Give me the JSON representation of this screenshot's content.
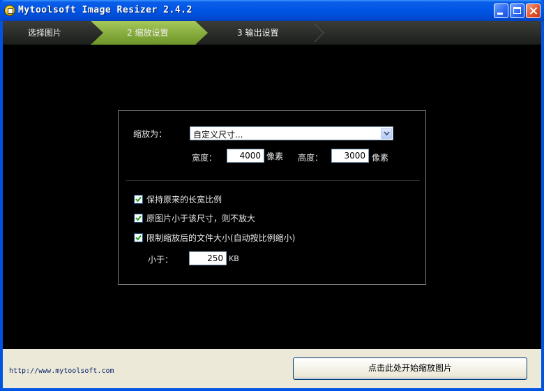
{
  "window": {
    "title": "Mytoolsoft Image Resizer 2.4.2"
  },
  "steps": [
    {
      "label": "选择图片"
    },
    {
      "label": "2  缩放设置"
    },
    {
      "label": "3  输出设置"
    }
  ],
  "resize": {
    "label": "缩放为：",
    "selected": "自定义尺寸...",
    "width_label": "宽度：",
    "width_value": "4000",
    "width_unit": "像素",
    "height_label": "高度：",
    "height_value": "3000",
    "height_unit": "像素"
  },
  "options": [
    {
      "label": "保持原来的长宽比例",
      "checked": true
    },
    {
      "label": "原图片小于该尺寸，则不放大",
      "checked": true
    },
    {
      "label": "限制缩放后的文件大小(自动按比例缩小)",
      "checked": true
    }
  ],
  "filesize": {
    "label": "小于：",
    "value": "250",
    "unit": "KB"
  },
  "footer": {
    "link": "http://www.mytoolsoft.com",
    "start_button": "点击此处开始缩放图片"
  },
  "colors": {
    "title_bar": "#0054e3",
    "step_active": "#8bb23f",
    "panel_bg": "#000000",
    "footer_bg": "#ece9d8"
  }
}
